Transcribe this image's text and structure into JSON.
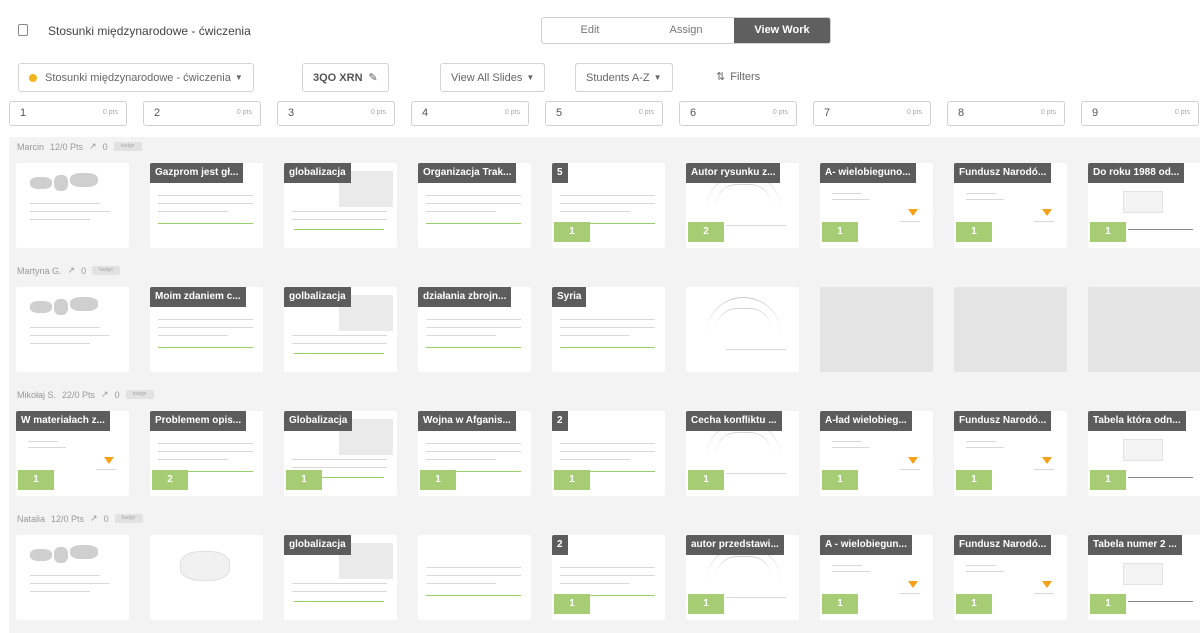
{
  "header": {
    "doc_title": "Stosunki międzynarodowe - ćwiczenia",
    "modes": [
      {
        "label": "Edit",
        "active": false
      },
      {
        "label": "Assign",
        "active": false
      },
      {
        "label": "View Work",
        "active": true
      }
    ]
  },
  "toolbar": {
    "class_select": "Stosunki międzynarodowe - ćwiczenia",
    "class_code": "3QO XRN",
    "view_select": "View All Slides",
    "sort_select": "Students A-Z",
    "filters_label": "Filters"
  },
  "slides": [
    {
      "num": "1",
      "pts": "0 pts"
    },
    {
      "num": "2",
      "pts": "0 pts"
    },
    {
      "num": "3",
      "pts": "0 pts"
    },
    {
      "num": "4",
      "pts": "0 pts"
    },
    {
      "num": "5",
      "pts": "0 pts"
    },
    {
      "num": "6",
      "pts": "0 pts"
    },
    {
      "num": "7",
      "pts": "0 pts"
    },
    {
      "num": "8",
      "pts": "0 pts"
    },
    {
      "num": "9",
      "pts": "0 pts"
    }
  ],
  "students": [
    {
      "name": "Marcin",
      "points": "12/0 Pts",
      "likes": "0",
      "badge": "badge",
      "tiles": [
        {
          "kind": "map",
          "overlay": "",
          "score": ""
        },
        {
          "kind": "text",
          "overlay": "Gazprom jest gł...",
          "score": ""
        },
        {
          "kind": "image",
          "overlay": "globalizacja",
          "score": ""
        },
        {
          "kind": "text",
          "overlay": "Organizacja Trak...",
          "score": ""
        },
        {
          "kind": "text",
          "overlay": "5",
          "score": "1"
        },
        {
          "kind": "chart",
          "overlay": "Autor rysunku z...",
          "score": "2"
        },
        {
          "kind": "tri",
          "overlay": "A- wielobieguno...",
          "score": "1"
        },
        {
          "kind": "tri",
          "overlay": "Fundusz Narodó...",
          "score": "1"
        },
        {
          "kind": "table",
          "overlay": "Do roku 1988 od...",
          "score": "1"
        }
      ]
    },
    {
      "name": "Martyna G.",
      "points": "",
      "likes": "0",
      "badge": "badge",
      "tiles": [
        {
          "kind": "map",
          "overlay": "",
          "score": ""
        },
        {
          "kind": "text",
          "overlay": "Moim zdaniem c...",
          "score": ""
        },
        {
          "kind": "image",
          "overlay": "golbalizacja",
          "score": ""
        },
        {
          "kind": "text",
          "overlay": "działania zbrojn...",
          "score": ""
        },
        {
          "kind": "text",
          "overlay": "Syria",
          "score": ""
        },
        {
          "kind": "chart",
          "overlay": "",
          "score": ""
        },
        {
          "kind": "empty",
          "overlay": "",
          "score": ""
        },
        {
          "kind": "empty",
          "overlay": "",
          "score": ""
        },
        {
          "kind": "empty",
          "overlay": "",
          "score": ""
        }
      ]
    },
    {
      "name": "Mikołaj S.",
      "points": "22/0 Pts",
      "likes": "0",
      "badge": "badge",
      "tiles": [
        {
          "kind": "tri",
          "overlay": "W materiałach z...",
          "score": "1"
        },
        {
          "kind": "text",
          "overlay": "Problemem opis...",
          "score": "2"
        },
        {
          "kind": "image",
          "overlay": "Globalizacja",
          "score": "1"
        },
        {
          "kind": "text",
          "overlay": "Wojna w Afganis...",
          "score": "1"
        },
        {
          "kind": "text",
          "overlay": "2",
          "score": "1"
        },
        {
          "kind": "chart",
          "overlay": "Cecha konfliktu ...",
          "score": "1"
        },
        {
          "kind": "tri",
          "overlay": "A-ład wielobieg...",
          "score": "1"
        },
        {
          "kind": "tri",
          "overlay": "Fundusz Narodó...",
          "score": "1"
        },
        {
          "kind": "table",
          "overlay": "Tabela która odn...",
          "score": "1"
        }
      ]
    },
    {
      "name": "Natalia",
      "points": "12/0 Pts",
      "likes": "0",
      "badge": "badge",
      "tiles": [
        {
          "kind": "map",
          "overlay": "",
          "score": ""
        },
        {
          "kind": "sketch",
          "overlay": "",
          "score": ""
        },
        {
          "kind": "image",
          "overlay": "globalizacja",
          "score": ""
        },
        {
          "kind": "text",
          "overlay": "",
          "score": ""
        },
        {
          "kind": "text",
          "overlay": "2",
          "score": "1"
        },
        {
          "kind": "chart",
          "overlay": "autor przedstawi...",
          "score": "1"
        },
        {
          "kind": "tri",
          "overlay": "A - wielobiegun...",
          "score": "1"
        },
        {
          "kind": "tri",
          "overlay": "Fundusz Narodó...",
          "score": "1"
        },
        {
          "kind": "table",
          "overlay": "Tabela numer 2 ...",
          "score": "1"
        }
      ]
    }
  ]
}
